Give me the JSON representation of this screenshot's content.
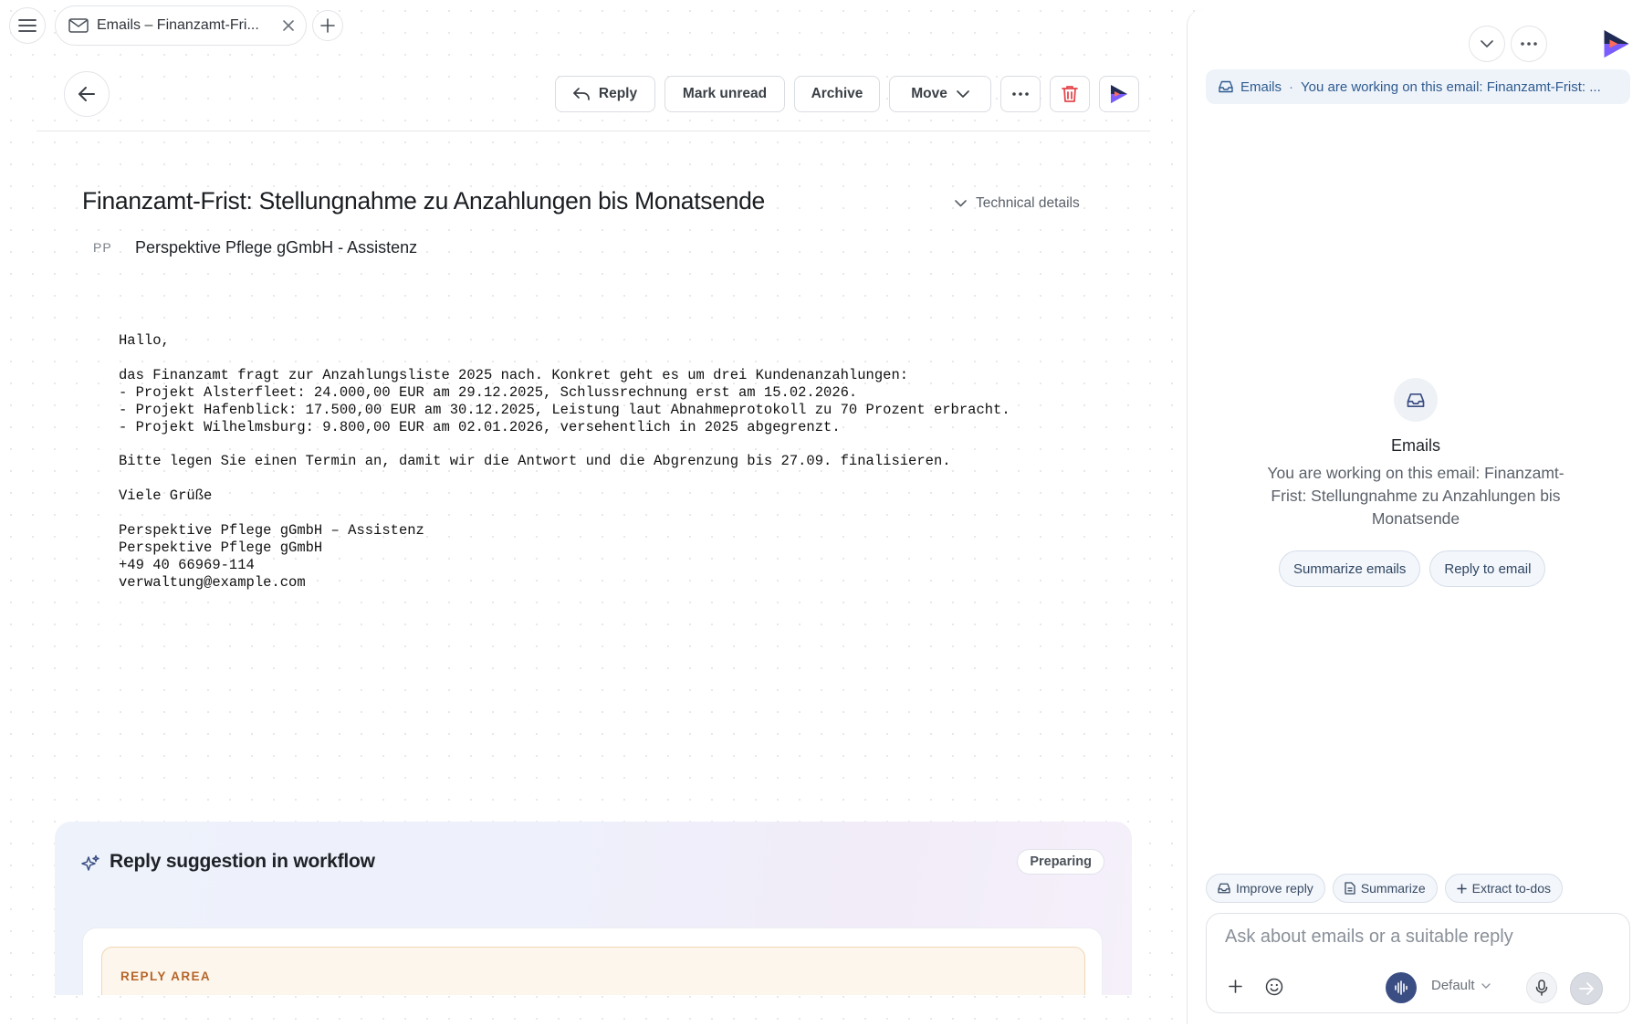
{
  "tab": {
    "title": "Emails – Finanzamt-Fri..."
  },
  "toolbar": {
    "reply_label": "Reply",
    "mark_unread_label": "Mark unread",
    "archive_label": "Archive",
    "move_label": "Move"
  },
  "email": {
    "subject": "Finanzamt-Frist: Stellungnahme zu Anzahlungen bis Monatsende",
    "technical_details_label": "Technical details",
    "sender_initials": "PP",
    "sender_name": "Perspektive Pflege gGmbH - Assistenz",
    "body": "Hallo,\n\ndas Finanzamt fragt zur Anzahlungsliste 2025 nach. Konkret geht es um drei Kundenanzahlungen:\n- Projekt Alsterfleet: 24.000,00 EUR am 29.12.2025, Schlussrechnung erst am 15.02.2026.\n- Projekt Hafenblick: 17.500,00 EUR am 30.12.2025, Leistung laut Abnahmeprotokoll zu 70 Prozent erbracht.\n- Projekt Wilhelmsburg: 9.800,00 EUR am 02.01.2026, versehentlich in 2025 abgegrenzt.\n\nBitte legen Sie einen Termin an, damit wir die Antwort und die Abgrenzung bis 27.09. finalisieren.\n\nViele Grüße\n\nPerspektive Pflege gGmbH – Assistenz\nPerspektive Pflege gGmbH\n+49 40 66969-114\nverwaltung@example.com"
  },
  "suggestion": {
    "title": "Reply suggestion in workflow",
    "status": "Preparing",
    "reply_area_label": "REPLY AREA"
  },
  "sidebar": {
    "context_source": "Emails",
    "context_separator": "·",
    "context_text": "You are working on this email: Finanzamt-Frist: ...",
    "empty_title": "Emails",
    "empty_description": "You are working on this email: Finanzamt-Frist: Stellungnahme zu Anzahlungen bis Monatsende",
    "suggestions": [
      "Summarize emails",
      "Reply to email"
    ],
    "actions": {
      "improve_reply": "Improve reply",
      "summarize": "Summarize",
      "extract_todos": "Extract to-dos"
    },
    "composer": {
      "placeholder": "Ask about emails or a suitable reply",
      "model": "Default"
    }
  },
  "colors": {
    "accent": "#3b4e84",
    "delete": "#e5484d",
    "reply_area_label": "#b5652a",
    "context_text": "#2f5b8f"
  }
}
